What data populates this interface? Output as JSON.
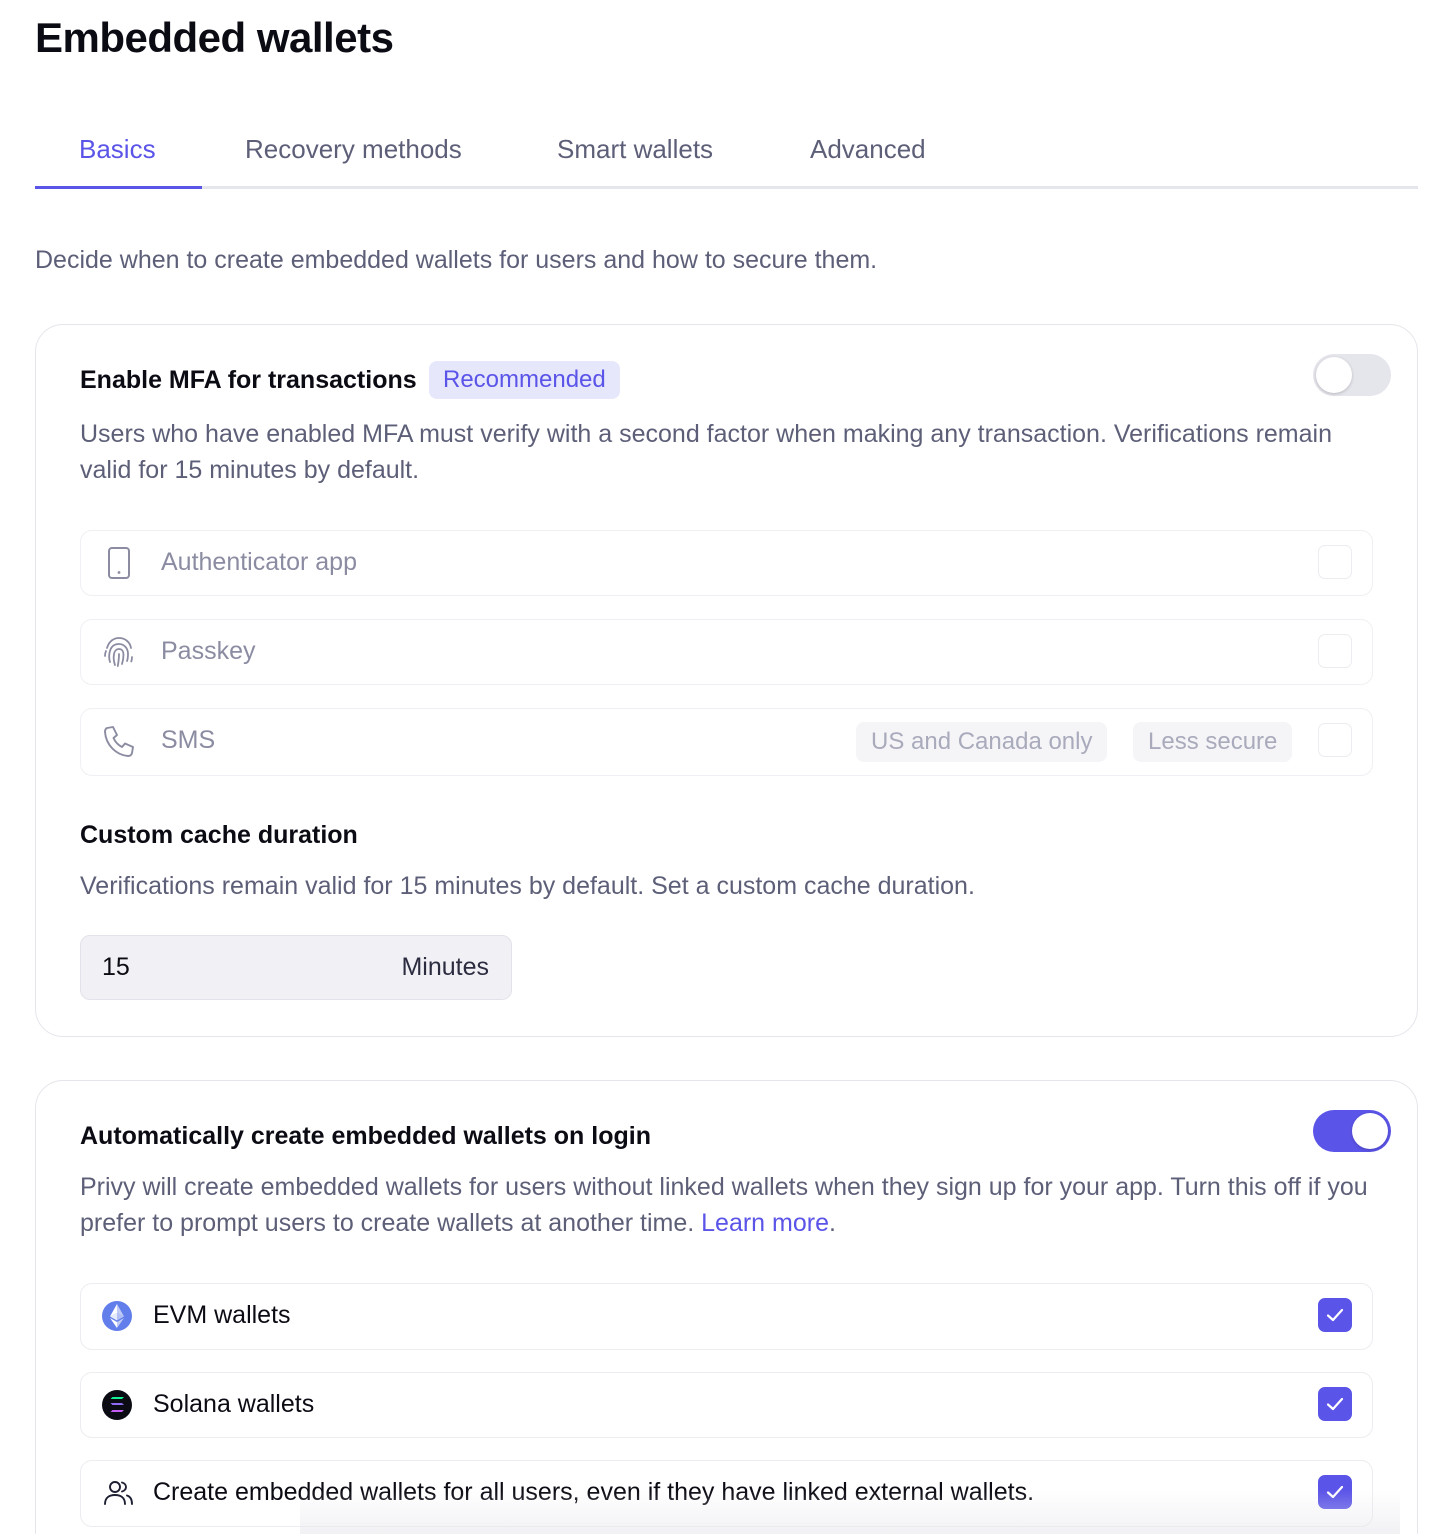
{
  "page": {
    "title": "Embedded wallets"
  },
  "tabs": [
    {
      "label": "Basics",
      "active": true
    },
    {
      "label": "Recovery methods",
      "active": false
    },
    {
      "label": "Smart wallets",
      "active": false
    },
    {
      "label": "Advanced",
      "active": false
    }
  ],
  "intro": "Decide when to create embedded wallets for users and how to secure them.",
  "mfa": {
    "title": "Enable MFA for transactions",
    "badge": "Recommended",
    "enabled": false,
    "description": "Users who have enabled MFA must verify with a second factor when making any transaction. Verifications remain valid for 15 minutes by default.",
    "methods": [
      {
        "label": "Authenticator app",
        "icon": "smartphone-icon",
        "checked": false
      },
      {
        "label": "Passkey",
        "icon": "fingerprint-icon",
        "checked": false
      },
      {
        "label": "SMS",
        "icon": "phone-icon",
        "checked": false,
        "tags": [
          "US and Canada only",
          "Less secure"
        ]
      }
    ],
    "cache": {
      "title": "Custom cache duration",
      "description": "Verifications remain valid for 15 minutes by default. Set a custom cache duration.",
      "value": "15",
      "unit": "Minutes"
    }
  },
  "auto_create": {
    "title": "Automatically create embedded wallets on login",
    "enabled": true,
    "description": "Privy will create embedded wallets for users without linked wallets when they sign up for your app. Turn this off if you prefer to prompt users to create wallets at another time.",
    "learn_more": "Learn more",
    "options": [
      {
        "label": "EVM wallets",
        "icon": "ethereum-icon",
        "checked": true
      },
      {
        "label": "Solana wallets",
        "icon": "solana-icon",
        "checked": true
      },
      {
        "label": "Create embedded wallets for all users, even if they have linked external wallets.",
        "icon": "users-icon",
        "checked": true
      }
    ]
  },
  "colors": {
    "accent": "#5b54e8",
    "text": "#0b0b14",
    "muted": "#5d5f78",
    "border": "#e5e5ec"
  }
}
